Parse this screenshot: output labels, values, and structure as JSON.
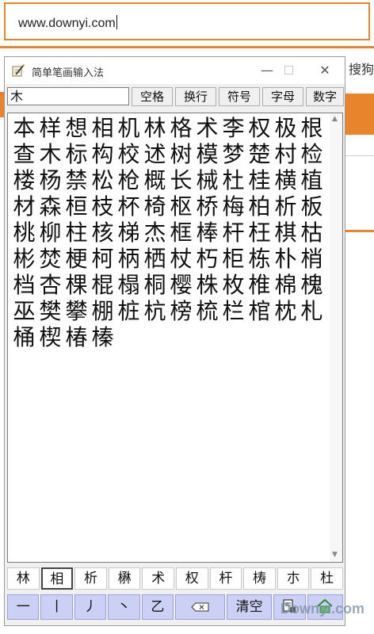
{
  "browser": {
    "url": "www.downyi.com",
    "right_fragment": "搜狗"
  },
  "ime": {
    "title": "简单笔画输入法",
    "input_value": "木",
    "buttons": {
      "space": "空格",
      "newline": "换行",
      "symbols": "符号",
      "letters": "字母",
      "numbers": "数字"
    },
    "results": [
      "本",
      "样",
      "想",
      "相",
      "机",
      "林",
      "格",
      "术",
      "李",
      "权",
      "极",
      "根",
      "查",
      "木",
      "标",
      "构",
      "校",
      "述",
      "树",
      "模",
      "梦",
      "楚",
      "村",
      "检",
      "楼",
      "杨",
      "禁",
      "松",
      "枪",
      "概",
      "长",
      "械",
      "杜",
      "桂",
      "横",
      "植",
      "材",
      "森",
      "桓",
      "枝",
      "杯",
      "椅",
      "枢",
      "桥",
      "梅",
      "柏",
      "析",
      "板",
      "桃",
      "柳",
      "柱",
      "核",
      "梯",
      "杰",
      "框",
      "棒",
      "杆",
      "枉",
      "棋",
      "枯",
      "彬",
      "焚",
      "梗",
      "柯",
      "柄",
      "栖",
      "杖",
      "朽",
      "柜",
      "栋",
      "朴",
      "梢",
      "档",
      "杏",
      "棵",
      "棍",
      "榻",
      "桐",
      "樱",
      "株",
      "枚",
      "椎",
      "棉",
      "槐",
      "巫",
      "樊",
      "攀",
      "棚",
      "桩",
      "杭",
      "榜",
      "梳",
      "栏",
      "棺",
      "枕",
      "札",
      "桶",
      "楔",
      "椿",
      "榛"
    ],
    "candidates": [
      "林",
      "相",
      "析",
      "楙",
      "术",
      "权",
      "杆",
      "梼",
      "朩",
      "杜"
    ],
    "selected_candidate_index": 1,
    "strokes": [
      "一",
      "丨",
      "丿",
      "丶",
      "乙"
    ],
    "clear_label": "清空"
  },
  "watermark": "Downyi.com",
  "colors": {
    "accent": "#e8842c",
    "stroke_button": "#ccd0f5"
  }
}
